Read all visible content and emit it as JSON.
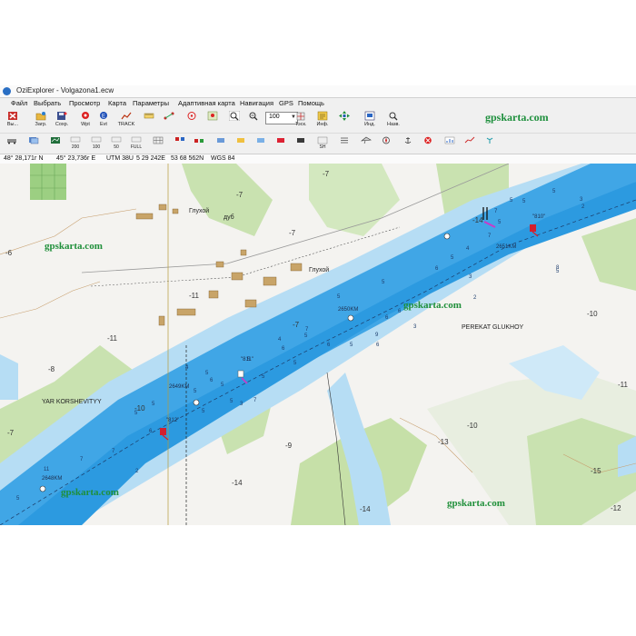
{
  "window": {
    "title": "OziExplorer - Volgazona1.ecw"
  },
  "menu": [
    "Файл",
    "Выбрать",
    "Просмотр",
    "Карта",
    "Параметры",
    "Адаптивная карта",
    "Навигация",
    "GPS",
    "Помощь"
  ],
  "toolbar_top": {
    "exit_label": "Вы...",
    "load_label": "Загр.",
    "save_label": "Сохр.",
    "wpt_label": "Wpt",
    "evt_label": "Evt",
    "track_label": "TRACK",
    "zoom_value": "100",
    "track_tool_label": "Тэск.",
    "info_label": "Инф.",
    "ind_label": "Инд.",
    "name_label": "Назв.",
    "brand": "gpskarta.com"
  },
  "toolbar_second": {
    "btn_200": "200",
    "btn_100": "100",
    "btn_50": "50",
    "btn_full": "FULL",
    "btn_sh": "SH"
  },
  "status": {
    "lat": "48° 28,171г N",
    "lon": "45° 23,736г E",
    "zone": "UTM  38U",
    "easting": "5 29 242E",
    "northing": "53 68 562N",
    "datum": "WGS 84"
  },
  "map": {
    "watermarks": [
      "gpskarta.com",
      "gpskarta.com",
      "gpskarta.com",
      "gpskarta.com"
    ],
    "place_labels": {
      "village1": "Глухой",
      "village2": "Глухой",
      "dub": "дуб",
      "yar": "YAR KORSHEVITYY",
      "perekat": "PEREKAT GLUKHOY"
    },
    "km_labels": {
      "km2651": "2651KM",
      "km2650": "2650KM",
      "km2649": "2649KM",
      "km2648": "2648KM",
      "b810": "\"810\"",
      "b811": "\"811\"",
      "b812": "\"812\""
    },
    "land_depths": {
      "d1": "-7",
      "d2": "-7",
      "d3": "-7",
      "d4": "-6",
      "d5": "-11",
      "d6": "-11",
      "d7": "-8",
      "d8": "-10",
      "d9": "-7",
      "d10": "-10",
      "d11": "-14",
      "d12": "-9",
      "d13": "-10",
      "d14": "-11",
      "d15": "-13",
      "d16": "-14",
      "d17": "-12",
      "d18": "-15",
      "d19": "-14",
      "d20": "-7"
    },
    "soundings": {
      "s1": "5",
      "s2": "5",
      "s3": "5",
      "s4": "5",
      "s5": "7",
      "s6": "5",
      "s7": "6",
      "s8": "5",
      "s9": "6",
      "s10": "5",
      "s11": "6",
      "s12": "5",
      "s13": "7",
      "s14": "5",
      "s15": "6",
      "s16": "5",
      "s17": "6",
      "s18": "3",
      "s19": "6",
      "s20": "5",
      "s21": "5",
      "s22": "4",
      "s23": "5",
      "s24": "5",
      "s25": "6",
      "s26": "5",
      "s27": "3",
      "s28": "2",
      "s29": "8",
      "s30": "3",
      "s31": "2",
      "s32": "5",
      "s33": "7",
      "s34": "4",
      "s35": "5",
      "s36": "5",
      "s37": "7",
      "s38": "5",
      "s39": "2",
      "s40": "11",
      "s41": "7",
      "s42": "7",
      "s43": "5",
      "s44": "4",
      "s45": "5",
      "s46": "6",
      "s47": "3",
      "s48": "9"
    }
  }
}
